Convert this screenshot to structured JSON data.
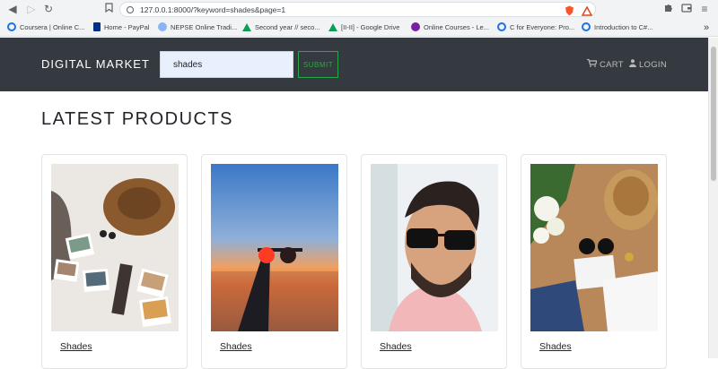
{
  "browser": {
    "url": "127.0.0.1:8000/?keyword=shades&page=1",
    "bookmarks": [
      {
        "label": "Coursera | Online C...",
        "color": "#1a73e8"
      },
      {
        "label": "Home - PayPal",
        "color": "#003087"
      },
      {
        "label": "NEPSE Online Tradi...",
        "color": "#8ab4f8"
      },
      {
        "label": "Second year // seco...",
        "color": "#0f9d58"
      },
      {
        "label": "[II-II] - Google Drive",
        "color": "#0f9d58"
      },
      {
        "label": "Online Courses - Le...",
        "color": "#7b1fa2"
      },
      {
        "label": "C for Everyone: Pro...",
        "color": "#1a73e8"
      },
      {
        "label": "Introduction to C#...",
        "color": "#1a73e8"
      }
    ],
    "more_bookmarks": "»"
  },
  "header": {
    "brand": "DIGITAL MARKET",
    "search": {
      "value": "shades",
      "submit_label": "SUBMIT"
    },
    "cart_label": "CART",
    "login_label": "LOGIN"
  },
  "main": {
    "heading": "LATEST PRODUCTS",
    "products": [
      {
        "name": "Shades",
        "image": "flatlay-hat-photos"
      },
      {
        "name": "Shades",
        "image": "hand-holding-sunglasses-sunset"
      },
      {
        "name": "Shades",
        "image": "man-wearing-sunglasses"
      },
      {
        "name": "Shades",
        "image": "summer-flatlay-bag-sunglasses"
      }
    ]
  },
  "colors": {
    "navbar": "#343a40",
    "accent_green": "#28a745",
    "input_bg": "#e8f0fe"
  }
}
